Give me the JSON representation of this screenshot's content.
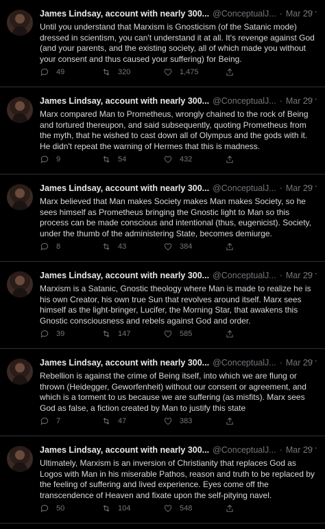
{
  "tweets": [
    {
      "name": "James Lindsay, account with nearly 300...",
      "handle": "@ConceptualJ...",
      "date": "Mar 29",
      "text": "Until you understand that Marxism is Gnosticism (of the Satanic mode) dressed in scientism, you can't understand it at all. It's revenge against God (and your parents, and the existing society, all of which made you without your consent and thus caused your suffering) for Being.",
      "replies": "49",
      "retweets": "320",
      "likes": "1,475"
    },
    {
      "name": "James Lindsay, account with nearly 300...",
      "handle": "@ConceptualJ...",
      "date": "Mar 29",
      "text": "Marx compared Man to Prometheus, wrongly chained to the rock of Being and tortured thereupon, and said subsequently, quoting Prometheus from the myth, that he wished to cast down all of Olympus and the gods with it. He didn't repeat the warning of Hermes that this is madness.",
      "replies": "9",
      "retweets": "54",
      "likes": "432"
    },
    {
      "name": "James Lindsay, account with nearly 300...",
      "handle": "@ConceptualJ...",
      "date": "Mar 29",
      "text": "Marx believed that Man makes Society makes Man makes Society, so he sees himself as Prometheus bringing the Gnostic light to Man so this process can be made conscious and intentional (thus, eugenicist). Society, under the thumb of the administering State, becomes demiurge.",
      "replies": "8",
      "retweets": "43",
      "likes": "384"
    },
    {
      "name": "James Lindsay, account with nearly 300...",
      "handle": "@ConceptualJ...",
      "date": "Mar 29",
      "text": "Marxism is a Satanic, Gnostic theology where Man is made to realize he is his own Creator, his own true Sun that revolves around itself. Marx sees himself as the light-bringer, Lucifer, the Morning Star, that awakens this Gnostic consciousness and rebels against God and order.",
      "replies": "39",
      "retweets": "147",
      "likes": "585"
    },
    {
      "name": "James Lindsay, account with nearly 300...",
      "handle": "@ConceptualJ...",
      "date": "Mar 29",
      "text": "Rebellion is against the crime of Being itself, into which we are flung or thrown (Heidegger, Geworfenheit) without our consent or agreement, and which is a torment to us because we are suffering (as misfits). Marx sees God as false, a fiction created by Man to justify this state",
      "replies": "7",
      "retweets": "47",
      "likes": "383"
    },
    {
      "name": "James Lindsay, account with nearly 300...",
      "handle": "@ConceptualJ...",
      "date": "Mar 29",
      "text": "Ultimately, Marxism is an inversion of Christianity that replaces God as Logos with Man in his miserable Pathos, reason and truth to be replaced by the feeling of suffering and lived experience. Eyes come off the transcendence of Heaven and fixate upon the self-pitying navel.",
      "replies": "50",
      "retweets": "104",
      "likes": "548"
    }
  ],
  "icons": {
    "reply": "reply-icon",
    "retweet": "retweet-icon",
    "like": "heart-icon",
    "share": "share-icon",
    "more": "more-icon"
  },
  "colors": {
    "background": "#000000",
    "text": "#d9d9d9",
    "muted": "#71767b",
    "divider": "#2f3336"
  }
}
